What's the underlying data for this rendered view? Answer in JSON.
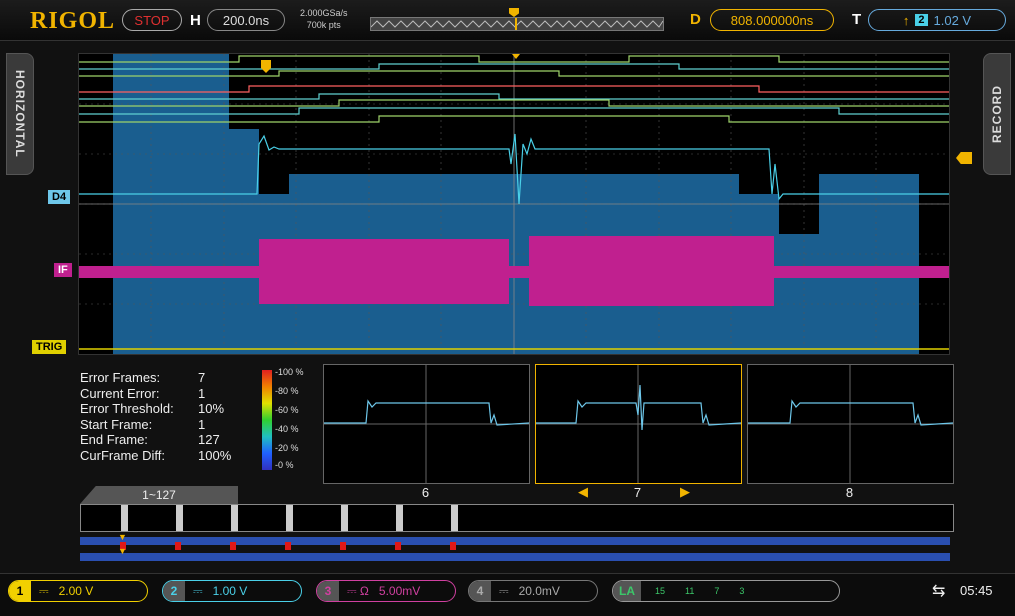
{
  "header": {
    "brand": "RIGOL",
    "run_state": "STOP",
    "horizontal_label": "H",
    "horizontal_scale": "200.0ns",
    "sample_rate": "2.000GSa/s",
    "memory_depth": "700k pts",
    "delay_label": "D",
    "delay_value": "808.000000ns",
    "trigger_label": "T",
    "trigger_source": "2",
    "trigger_level": "1.02 V"
  },
  "side_tabs": {
    "left": "HORIZONTAL",
    "right": "RECORD"
  },
  "channels_on_screen": {
    "d4": "D4",
    "math": "IF",
    "trig": "TRIG"
  },
  "info": {
    "rows": [
      {
        "label": "Error Frames:",
        "value": "7"
      },
      {
        "label": "Current Error:",
        "value": "1"
      },
      {
        "label": "Error Threshold:",
        "value": "10%"
      },
      {
        "label": "Start Frame:",
        "value": "1"
      },
      {
        "label": "End Frame:",
        "value": "127"
      },
      {
        "label": "CurFrame Diff:",
        "value": "100%"
      }
    ],
    "scale_labels": [
      "-100 %",
      "-80 %",
      "-60 %",
      "-40 %",
      "-20 %",
      "-0 %"
    ]
  },
  "thumbnails": [
    "6",
    "7",
    "8"
  ],
  "frame_range": "1~127",
  "bottom": {
    "ch1": {
      "num": "1",
      "coupling": "⎓",
      "scale": "2.00 V",
      "color": "#f1d000"
    },
    "ch2": {
      "num": "2",
      "coupling": "⎓",
      "scale": "1.00 V",
      "color": "#4ad0e8"
    },
    "ch3": {
      "num": "3",
      "coupling": "⎓ Ω",
      "scale": "5.00mV",
      "color": "#d040a0"
    },
    "ch4": {
      "num": "4",
      "coupling": "⎓",
      "scale": "20.0mV",
      "color": "#3060e0"
    },
    "la": {
      "label": "LA",
      "groups": [
        "15",
        "11",
        "7",
        "3"
      ]
    },
    "time": "05:45"
  }
}
